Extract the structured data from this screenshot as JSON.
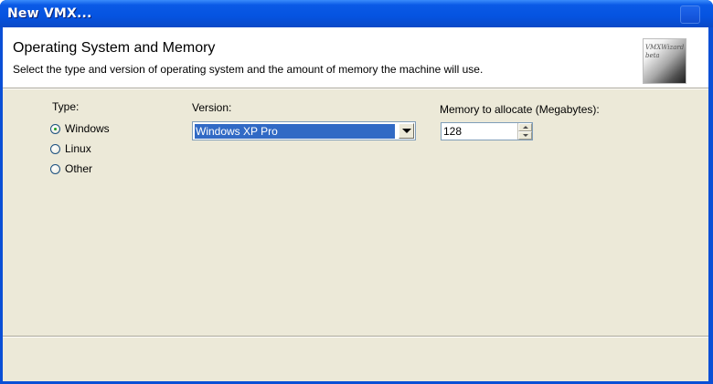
{
  "window": {
    "title": "New VMX..."
  },
  "banner": {
    "heading": "Operating System and Memory",
    "description": "Select the type and version of operating system and the amount of memory the machine will use.",
    "logo_line1": "VMXWizard",
    "logo_line2": "beta"
  },
  "os_type": {
    "label": "Type:",
    "options": [
      {
        "label": "Windows",
        "selected": true
      },
      {
        "label": "Linux",
        "selected": false
      },
      {
        "label": "Other",
        "selected": false
      }
    ]
  },
  "version": {
    "label": "Version:",
    "selected": "Windows XP Pro"
  },
  "memory": {
    "label": "Memory to allocate  (Megabytes):",
    "value": "128"
  },
  "colors": {
    "titlebar": "#0553e0",
    "dialog_bg": "#ece9d8",
    "selection": "#316ac5",
    "radio_dot": "#21a121"
  }
}
